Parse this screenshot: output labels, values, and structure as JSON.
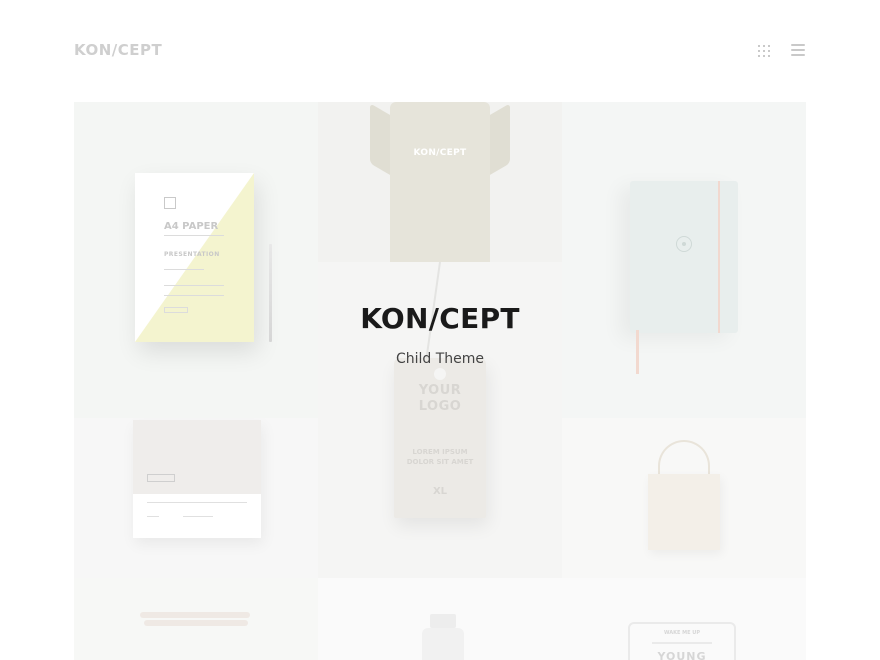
{
  "header": {
    "logo": "KON/CEPT",
    "grid_icon": "grid-dots-icon",
    "menu_icon": "hamburger-menu-icon"
  },
  "hero": {
    "title": "KON/CEPT",
    "subtitle": "Child Theme"
  },
  "portfolio": {
    "paper": {
      "title": "A4 PAPER",
      "sub": "PRESENTATION"
    },
    "shirt": {
      "text": "KON/CEPT"
    },
    "tag": {
      "logo_line1": "YOUR",
      "logo_line2": "LOGO",
      "small1": "LOREM IPSUM",
      "small2": "DOLOR SIT AMET",
      "size": "XL"
    },
    "badge": {
      "small": "WAKE ME UP",
      "text": "YOUNG"
    }
  },
  "colors": {
    "background": "#ffffff",
    "title_text": "#1a1a1a",
    "logo": "#cfcfcf"
  }
}
